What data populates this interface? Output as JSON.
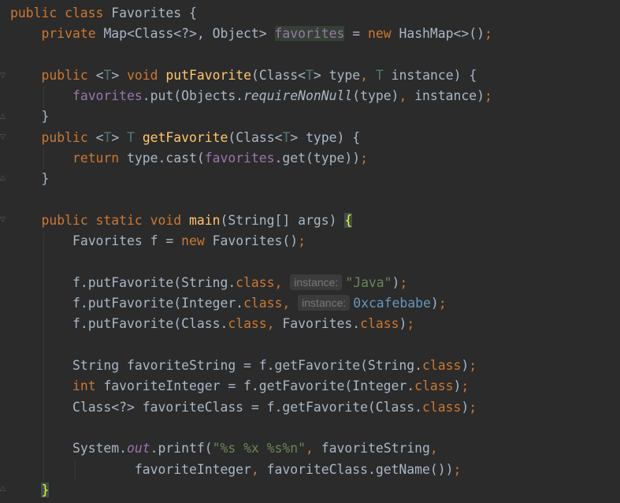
{
  "editor": {
    "hints": {
      "param_instance": "instance:"
    },
    "lines": [
      [
        {
          "t": "public class ",
          "c": "kw"
        },
        {
          "t": "Favorites {"
        }
      ],
      [
        {
          "t": "    "
        },
        {
          "t": "private ",
          "c": "kw"
        },
        {
          "t": "Map<Class<?>, Object> "
        },
        {
          "t": "favorites",
          "c": "fld hl-read"
        },
        {
          "t": " = "
        },
        {
          "t": "new ",
          "c": "kw"
        },
        {
          "t": "HashMap<>()"
        },
        {
          "t": ";",
          "c": "kw"
        }
      ],
      [],
      [
        {
          "t": "    "
        },
        {
          "t": "public ",
          "c": "kw"
        },
        {
          "t": "<"
        },
        {
          "t": "T",
          "c": "tp"
        },
        {
          "t": "> "
        },
        {
          "t": "void ",
          "c": "kw"
        },
        {
          "t": "putFavorite",
          "c": "fn"
        },
        {
          "t": "(Class<"
        },
        {
          "t": "T",
          "c": "tp"
        },
        {
          "t": "> type"
        },
        {
          "t": ", ",
          "c": "kw"
        },
        {
          "t": "T",
          "c": "tp"
        },
        {
          "t": " instance) {"
        }
      ],
      [
        {
          "t": "        "
        },
        {
          "t": "favorites",
          "c": "fld"
        },
        {
          "t": ".put(Objects."
        },
        {
          "t": "requireNonNull",
          "c": "it"
        },
        {
          "t": "(type)"
        },
        {
          "t": ", ",
          "c": "kw"
        },
        {
          "t": "instance)"
        },
        {
          "t": ";",
          "c": "kw"
        }
      ],
      [
        {
          "t": "    }"
        }
      ],
      [
        {
          "t": "    "
        },
        {
          "t": "public ",
          "c": "kw"
        },
        {
          "t": "<"
        },
        {
          "t": "T",
          "c": "tp"
        },
        {
          "t": "> "
        },
        {
          "t": "T",
          "c": "tp"
        },
        {
          "t": " "
        },
        {
          "t": "getFavorite",
          "c": "fn"
        },
        {
          "t": "(Class<"
        },
        {
          "t": "T",
          "c": "tp"
        },
        {
          "t": "> type) {"
        }
      ],
      [
        {
          "t": "        "
        },
        {
          "t": "return ",
          "c": "kw"
        },
        {
          "t": "type.cast("
        },
        {
          "t": "favorites",
          "c": "fld"
        },
        {
          "t": ".get(type))"
        },
        {
          "t": ";",
          "c": "kw"
        }
      ],
      [
        {
          "t": "    }"
        }
      ],
      [],
      [
        {
          "t": "    "
        },
        {
          "t": "public static void ",
          "c": "kw"
        },
        {
          "t": "main",
          "c": "fn"
        },
        {
          "t": "(String[] args) "
        },
        {
          "t": "{",
          "c": "brace-match"
        }
      ],
      [
        {
          "t": "        "
        },
        {
          "t": "Favorites f = "
        },
        {
          "t": "new ",
          "c": "kw"
        },
        {
          "t": "Favorites()"
        },
        {
          "t": ";",
          "c": "kw"
        }
      ],
      [],
      [
        {
          "t": "        "
        },
        {
          "t": "f.putFavorite(String."
        },
        {
          "t": "class",
          "c": "kw"
        },
        {
          "t": ", ",
          "c": "kw"
        },
        {
          "h": "param_instance"
        },
        {
          "t": "\"Java\"",
          "c": "str"
        },
        {
          "t": ")"
        },
        {
          "t": ";",
          "c": "kw"
        }
      ],
      [
        {
          "t": "        "
        },
        {
          "t": "f.putFavorite(Integer."
        },
        {
          "t": "class",
          "c": "kw"
        },
        {
          "t": ", ",
          "c": "kw"
        },
        {
          "h": "param_instance"
        },
        {
          "t": "0xcafebabe",
          "c": "num"
        },
        {
          "t": ")"
        },
        {
          "t": ";",
          "c": "kw"
        }
      ],
      [
        {
          "t": "        "
        },
        {
          "t": "f.putFavorite(Class."
        },
        {
          "t": "class",
          "c": "kw"
        },
        {
          "t": ", ",
          "c": "kw"
        },
        {
          "t": "Favorites."
        },
        {
          "t": "class",
          "c": "kw"
        },
        {
          "t": ")"
        },
        {
          "t": ";",
          "c": "kw"
        }
      ],
      [],
      [
        {
          "t": "        "
        },
        {
          "t": "String favoriteString = f.getFavorite(String."
        },
        {
          "t": "class",
          "c": "kw"
        },
        {
          "t": ")"
        },
        {
          "t": ";",
          "c": "kw"
        }
      ],
      [
        {
          "t": "        "
        },
        {
          "t": "int ",
          "c": "kw"
        },
        {
          "t": "favoriteInteger = f.getFavorite(Integer."
        },
        {
          "t": "class",
          "c": "kw"
        },
        {
          "t": ")"
        },
        {
          "t": ";",
          "c": "kw"
        }
      ],
      [
        {
          "t": "        "
        },
        {
          "t": "Class<?> favoriteClass = f.getFavorite(Class."
        },
        {
          "t": "class",
          "c": "kw"
        },
        {
          "t": ")"
        },
        {
          "t": ";",
          "c": "kw"
        }
      ],
      [],
      [
        {
          "t": "        "
        },
        {
          "t": "System."
        },
        {
          "t": "out",
          "c": "sfld"
        },
        {
          "t": ".printf("
        },
        {
          "t": "\"%s %x %s%n\"",
          "c": "str"
        },
        {
          "t": ", ",
          "c": "kw"
        },
        {
          "t": "favoriteString"
        },
        {
          "t": ",",
          "c": "kw"
        }
      ],
      [
        {
          "t": "                "
        },
        {
          "t": "favoriteInteger"
        },
        {
          "t": ", ",
          "c": "kw"
        },
        {
          "t": "favoriteClass.getName())"
        },
        {
          "t": ";",
          "c": "kw"
        }
      ],
      [
        {
          "t": "    "
        },
        {
          "t": "}",
          "c": "brace-match"
        }
      ]
    ]
  }
}
